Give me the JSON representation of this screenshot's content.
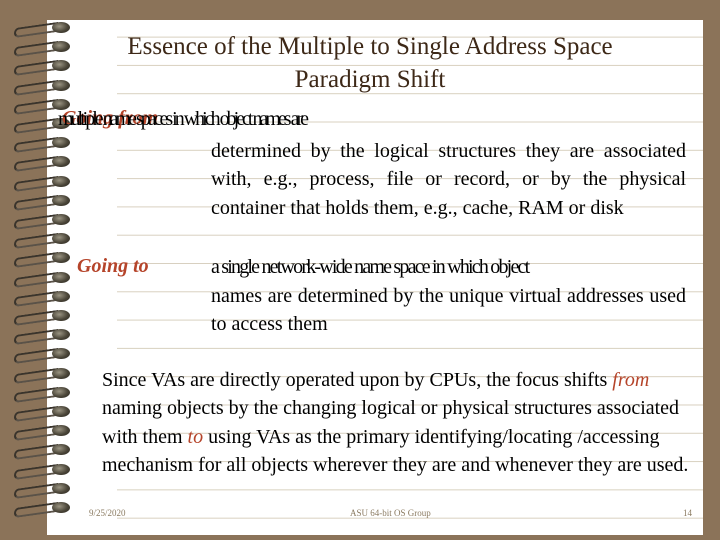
{
  "slide": {
    "title": "Essence of the Multiple to Single Address Space Paradigm Shift",
    "going_from": {
      "label": "Going from",
      "overlapping_text": "multiple name spaces in which object names are",
      "definition": "determined by the logical structures they are associated with, e.g., process, file or record, or by the physical container that holds them, e.g., cache, RAM or disk"
    },
    "going_to": {
      "label": "Going to",
      "first_line": "a single network-wide name space in which object",
      "definition": "names are determined by the unique virtual addresses used to access them"
    },
    "summary": {
      "part1": "Since VAs are directly operated upon by CPUs, the focus shifts ",
      "from_word": "from",
      "part2": " naming objects by the changing logical or physical structures associated with them ",
      "to_word": "to",
      "part3": " using VAs as the primary identifying/locating /accessing mechanism for all objects wherever they are and whenever they are used."
    },
    "footer": {
      "date": "9/25/2020",
      "center": "ASU 64-bit OS Group",
      "page_number": "14"
    },
    "colors": {
      "background": "#8b7359",
      "accent": "#b5442a",
      "title": "#3d2817"
    }
  }
}
